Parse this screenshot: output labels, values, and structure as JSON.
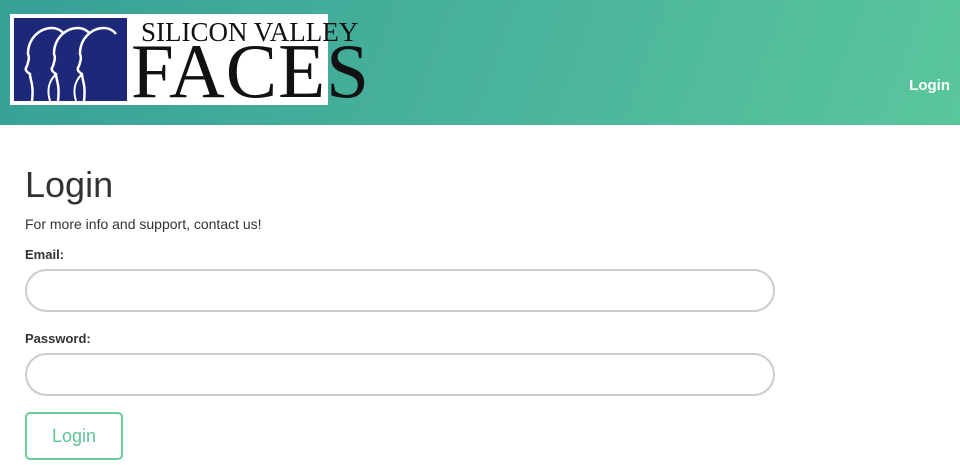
{
  "brand": {
    "logo_line1": "SILICON VALLEY",
    "logo_line2": "FACES",
    "logo_color": "#1e2878"
  },
  "nav": {
    "login_label": "Login"
  },
  "page": {
    "title": "Login",
    "subtitle": "For more info and support, contact us!"
  },
  "form": {
    "email_label": "Email:",
    "email_value": "",
    "password_label": "Password:",
    "password_value": "",
    "submit_label": "Login"
  },
  "colors": {
    "header_gradient_start": "#37a096",
    "header_gradient_end": "#5ac69c",
    "button_accent": "#5fc493"
  }
}
